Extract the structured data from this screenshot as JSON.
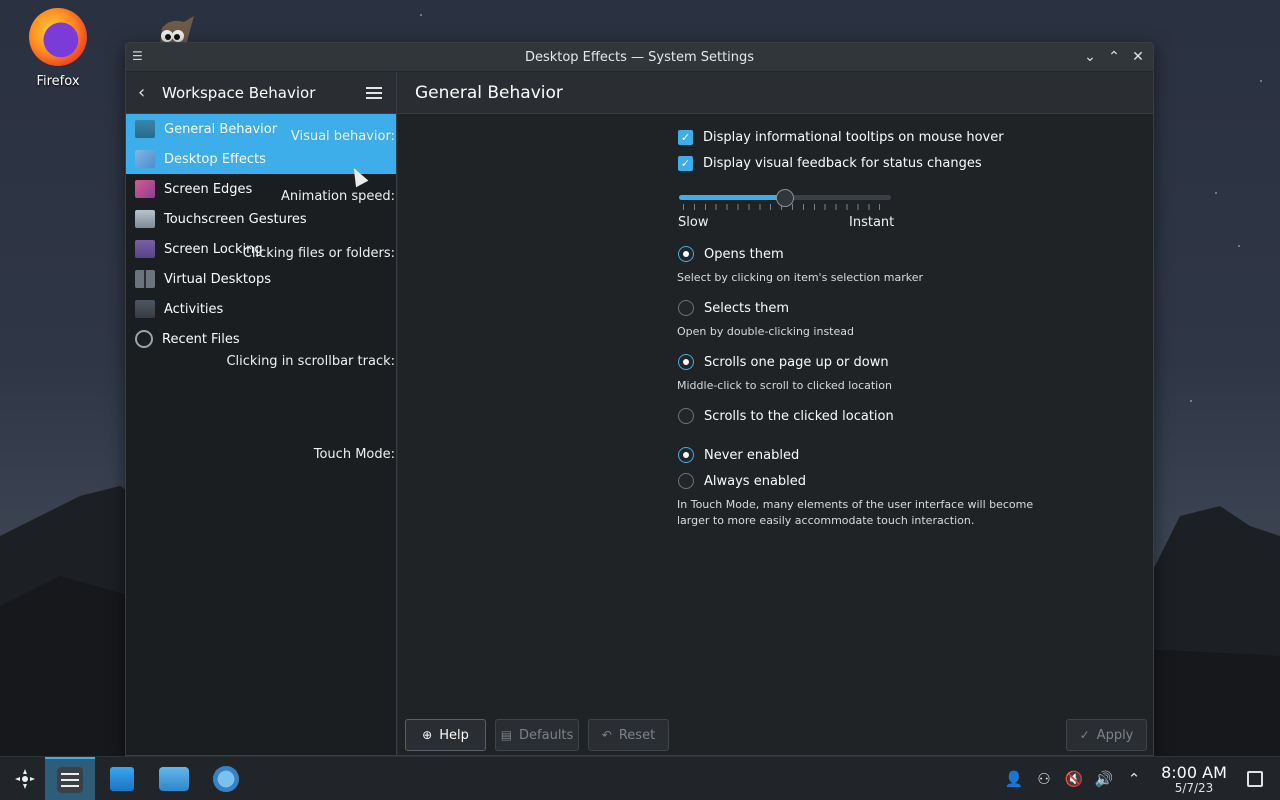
{
  "desktop": {
    "firefox_label": "Firefox"
  },
  "window": {
    "title": "Desktop Effects — System Settings",
    "sidebar": {
      "title": "Workspace Behavior",
      "items": [
        {
          "label": "General Behavior",
          "icon": "general-behavior-icon",
          "selected": true
        },
        {
          "label": "Desktop Effects",
          "icon": "desktop-effects-icon",
          "selected": true
        },
        {
          "label": "Screen Edges",
          "icon": "screen-edges-icon",
          "selected": false
        },
        {
          "label": "Touchscreen Gestures",
          "icon": "touchscreen-gestures-icon",
          "selected": false
        },
        {
          "label": "Screen Locking",
          "icon": "screen-locking-icon",
          "selected": false
        },
        {
          "label": "Virtual Desktops",
          "icon": "virtual-desktops-icon",
          "selected": false
        },
        {
          "label": "Activities",
          "icon": "activities-icon",
          "selected": false
        },
        {
          "label": "Recent Files",
          "icon": "recent-files-icon",
          "selected": false
        }
      ]
    },
    "main": {
      "title": "General Behavior",
      "visual_behavior": {
        "label": "Visual behavior:",
        "option1": "Display informational tooltips on mouse hover",
        "option1_checked": true,
        "option2": "Display visual feedback for status changes",
        "option2_checked": true
      },
      "animation_speed": {
        "label": "Animation speed:",
        "min_label": "Slow",
        "max_label": "Instant",
        "value": 0.5
      },
      "clicking_files": {
        "label": "Clicking files or folders:",
        "opens": "Opens them",
        "opens_hint": "Select by clicking on item's selection marker",
        "selects": "Selects them",
        "selects_hint": "Open by double-clicking instead",
        "selected": "opens"
      },
      "scrollbar": {
        "label": "Clicking in scrollbar track:",
        "page": "Scrolls one page up or down",
        "page_hint": "Middle-click to scroll to clicked location",
        "clicked": "Scrolls to the clicked location",
        "selected": "page"
      },
      "touch_mode": {
        "label": "Touch Mode:",
        "never": "Never enabled",
        "always": "Always enabled",
        "hint_line1": "In Touch Mode, many elements of the user interface will become",
        "hint_line2": "larger to more easily accommodate touch interaction.",
        "selected": "never"
      }
    },
    "buttons": {
      "help": "Help",
      "defaults": "Defaults",
      "reset": "Reset",
      "apply": "Apply"
    }
  },
  "taskbar": {
    "time": "8:00 AM",
    "date": "5/7/23"
  },
  "colors": {
    "accent": "#3daee9",
    "window_bg": "#202326",
    "sidebar_bg": "#1b1e21"
  }
}
